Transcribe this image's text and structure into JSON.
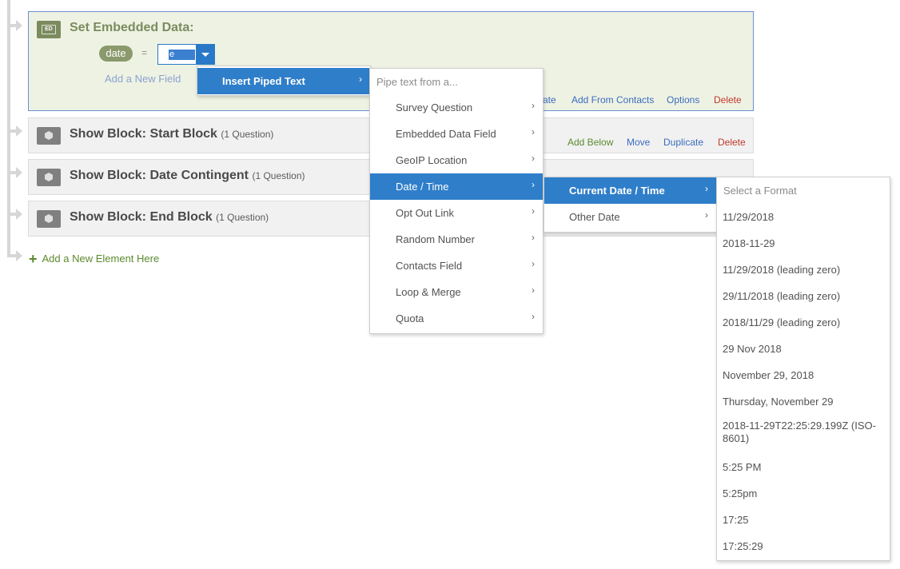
{
  "embedded_data": {
    "title": "Set Embedded Data:",
    "icon_label": "ED",
    "field_name": "date",
    "equals": "=",
    "value_text": "e",
    "add_field": "Add a New Field",
    "actions": [
      "ate",
      "Add From Contacts",
      "Options",
      "Delete"
    ]
  },
  "blocks": [
    {
      "title": "Show Block: Start Block",
      "count": "(1 Question)",
      "actions": [
        "Add Below",
        "Move",
        "Duplicate",
        "Delete"
      ]
    },
    {
      "title": "Show Block: Date Contingent",
      "count": "(1 Question)"
    },
    {
      "title": "Show Block: End Block",
      "count": "(1 Question)"
    }
  ],
  "add_element": {
    "plus": "+",
    "label": "Add a New Element Here"
  },
  "menu_insert": {
    "label": "Insert Piped Text",
    "chevron": "›"
  },
  "menu_pipe": {
    "header": "Pipe text from a...",
    "items": [
      "Survey Question",
      "Embedded Data Field",
      "GeoIP Location",
      "Date / Time",
      "Opt Out Link",
      "Random Number",
      "Contacts Field",
      "Loop & Merge",
      "Quota"
    ],
    "active": "Date / Time",
    "chevron": "›"
  },
  "menu_date": {
    "items": [
      "Current Date / Time",
      "Other Date"
    ],
    "active": "Current Date / Time",
    "chevron": "›"
  },
  "menu_format": {
    "header": "Select a Format",
    "items": [
      "11/29/2018",
      "2018-11-29",
      "11/29/2018 (leading zero)",
      "29/11/2018 (leading zero)",
      "2018/11/29 (leading zero)",
      "29 Nov 2018",
      "November 29, 2018",
      "Thursday, November 29",
      "2018-11-29T22:25:29.199Z (ISO-8601)",
      "5:25 PM",
      "5:25pm",
      "17:25",
      "17:25:29"
    ]
  },
  "colors": {
    "accent_blue": "#2f7ec9",
    "ed_green": "#7b8b5f",
    "add_green": "#5b8a2d",
    "link_blue": "#3b6cbf",
    "delete_red": "#c0392b"
  },
  "icons": {
    "connector": "arrow-right-icon",
    "block": "cube-icon",
    "embedded": "ed-icon",
    "dropdown": "caret-down-icon",
    "submenu": "chevron-right-icon",
    "add": "plus-icon"
  }
}
